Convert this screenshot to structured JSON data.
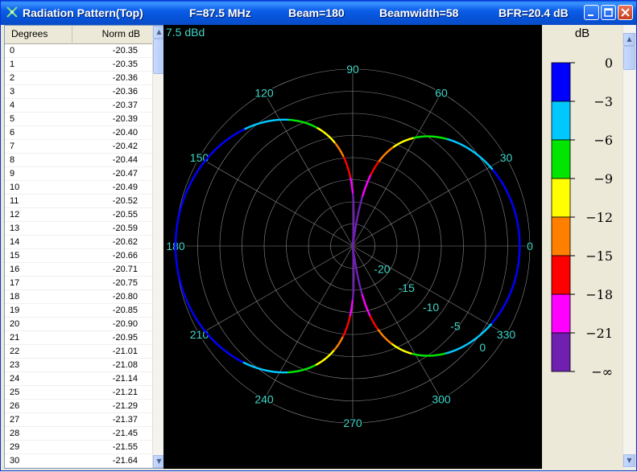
{
  "window": {
    "title": "Radiation Pattern(Top)",
    "freq": "F=87.5 MHz",
    "beam": "Beam=180",
    "beamwidth": "Beamwidth=58",
    "bfr": "BFR=20.4 dB"
  },
  "table": {
    "col_degrees": "Degrees",
    "col_norm": "Norm dB",
    "rows": [
      {
        "deg": "0",
        "db": "-20.35"
      },
      {
        "deg": "1",
        "db": "-20.35"
      },
      {
        "deg": "2",
        "db": "-20.36"
      },
      {
        "deg": "3",
        "db": "-20.36"
      },
      {
        "deg": "4",
        "db": "-20.37"
      },
      {
        "deg": "5",
        "db": "-20.39"
      },
      {
        "deg": "6",
        "db": "-20.40"
      },
      {
        "deg": "7",
        "db": "-20.42"
      },
      {
        "deg": "8",
        "db": "-20.44"
      },
      {
        "deg": "9",
        "db": "-20.47"
      },
      {
        "deg": "10",
        "db": "-20.49"
      },
      {
        "deg": "11",
        "db": "-20.52"
      },
      {
        "deg": "12",
        "db": "-20.55"
      },
      {
        "deg": "13",
        "db": "-20.59"
      },
      {
        "deg": "14",
        "db": "-20.62"
      },
      {
        "deg": "15",
        "db": "-20.66"
      },
      {
        "deg": "16",
        "db": "-20.71"
      },
      {
        "deg": "17",
        "db": "-20.75"
      },
      {
        "deg": "18",
        "db": "-20.80"
      },
      {
        "deg": "19",
        "db": "-20.85"
      },
      {
        "deg": "20",
        "db": "-20.90"
      },
      {
        "deg": "21",
        "db": "-20.95"
      },
      {
        "deg": "22",
        "db": "-21.01"
      },
      {
        "deg": "23",
        "db": "-21.08"
      },
      {
        "deg": "24",
        "db": "-21.14"
      },
      {
        "deg": "25",
        "db": "-21.21"
      },
      {
        "deg": "26",
        "db": "-21.29"
      },
      {
        "deg": "27",
        "db": "-21.37"
      },
      {
        "deg": "28",
        "db": "-21.45"
      },
      {
        "deg": "29",
        "db": "-21.55"
      },
      {
        "deg": "30",
        "db": "-21.64"
      }
    ]
  },
  "plot": {
    "gain_label": "7.5 dBd",
    "angle_labels": [
      "0",
      "30",
      "60",
      "90",
      "120",
      "150",
      "180",
      "210",
      "240",
      "270",
      "300",
      "330"
    ],
    "ring_labels": [
      "-20",
      "-15",
      "-10",
      "-5",
      "0"
    ],
    "colors": {
      "grid": "#8a8a8a",
      "label": "#3fd6c8",
      "background": "#000000"
    }
  },
  "legend": {
    "unit": "dB",
    "labels": [
      "0",
      "−3",
      "−6",
      "−9",
      "−12",
      "−15",
      "−18",
      "−21",
      "−∞"
    ],
    "colors": [
      "#0000ff",
      "#00c8ff",
      "#00e600",
      "#ffff00",
      "#ff8000",
      "#ff0000",
      "#ff00ff",
      "#7020b0"
    ]
  }
}
